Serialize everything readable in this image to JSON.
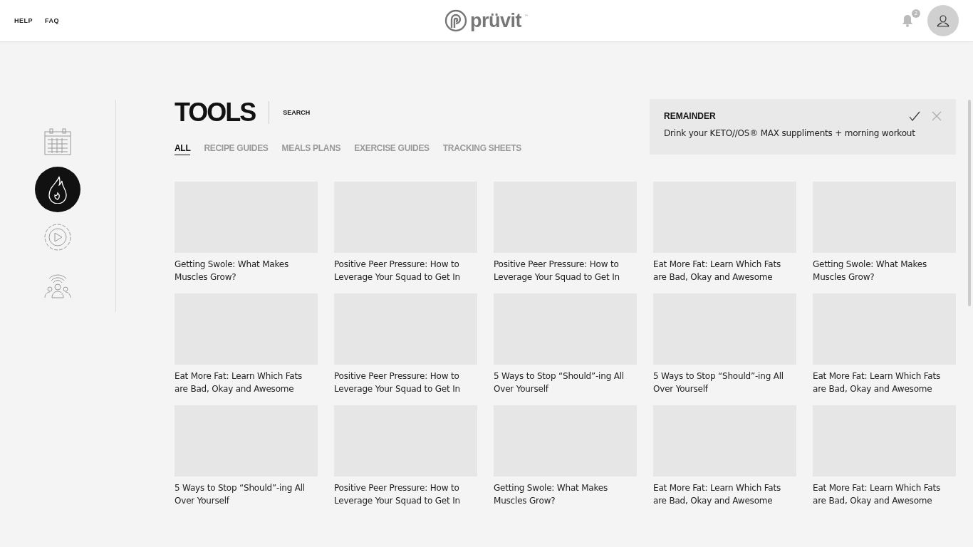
{
  "header": {
    "links": [
      "HELP",
      "FAQ"
    ],
    "logo": {
      "text": "prüvit",
      "mark": "™"
    },
    "notifications": {
      "count": "2"
    }
  },
  "sidebar": {
    "items": [
      {
        "kind": "calendar",
        "selected": false
      },
      {
        "kind": "flame",
        "selected": true
      },
      {
        "kind": "play",
        "selected": false
      },
      {
        "kind": "community",
        "selected": false
      }
    ]
  },
  "page": {
    "title": "TOOLS",
    "search": "SEARCH"
  },
  "tabs": [
    {
      "label": "ALL",
      "selected": true
    },
    {
      "label": "RECIPE GUIDES",
      "selected": false
    },
    {
      "label": "MEALS PLANS",
      "selected": false
    },
    {
      "label": "EXERCISE GUIDES",
      "selected": false
    },
    {
      "label": "TRACKING SHEETS",
      "selected": false
    }
  ],
  "reminder": {
    "title": "REMAINDER",
    "text": "Drink your KETO//OS® MAX suppliments + morning workout"
  },
  "cards": [
    {
      "title": "Getting Swole: What Makes Muscles Grow?"
    },
    {
      "title": "Positive Peer Pressure: How to Leverage Your Squad to Get In"
    },
    {
      "title": "Positive Peer Pressure: How to Leverage Your Squad to Get In"
    },
    {
      "title": "Eat More Fat: Learn Which Fats are Bad, Okay and Awesome"
    },
    {
      "title": "Getting Swole: What Makes Muscles Grow?"
    },
    {
      "title": "Eat More Fat: Learn Which Fats are Bad, Okay and Awesome"
    },
    {
      "title": "Positive Peer Pressure: How to Leverage Your Squad to Get In"
    },
    {
      "title": "5 Ways to Stop “Should”-ing All Over Yourself"
    },
    {
      "title": "5 Ways to Stop “Should”-ing All Over Yourself"
    },
    {
      "title": "Eat More Fat: Learn Which Fats are Bad, Okay and Awesome"
    },
    {
      "title": "5 Ways to Stop “Should”-ing All Over Yourself"
    },
    {
      "title": "Positive Peer Pressure: How to Leverage Your Squad to Get In"
    },
    {
      "title": "Getting Swole: What Makes Muscles Grow?"
    },
    {
      "title": "Eat More Fat: Learn Which Fats are Bad, Okay and Awesome"
    },
    {
      "title": "Eat More Fat: Learn Which Fats are Bad, Okay and Awesome"
    }
  ]
}
